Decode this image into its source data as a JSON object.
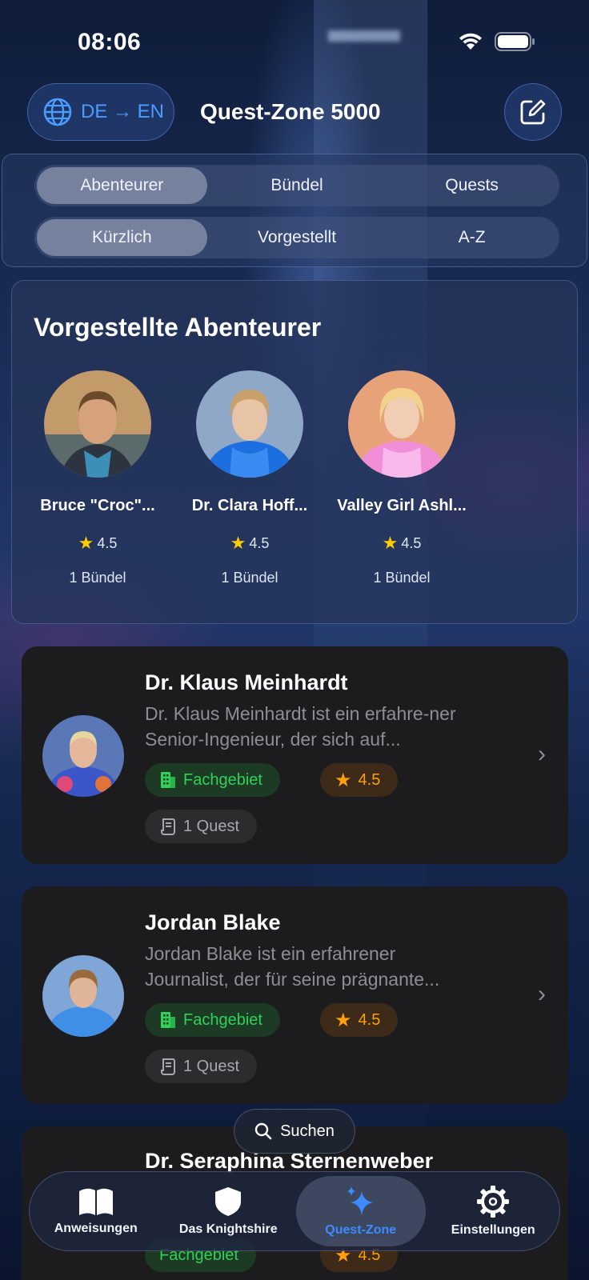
{
  "status": {
    "time": "08:06"
  },
  "header": {
    "language": "DE → EN",
    "title": "Quest-Zone 5000"
  },
  "tabs_primary": [
    "Abenteurer",
    "Bündel",
    "Quests"
  ],
  "tabs_sort": [
    "Kürzlich",
    "Vorgestellt",
    "A-Z"
  ],
  "featured": {
    "title": "Vorgestellte Abenteurer",
    "adventurers": [
      {
        "name": "Bruce \"Croc\"...",
        "rating": "4.5",
        "bundles": "1 Bündel"
      },
      {
        "name": "Dr. Clara Hoff...",
        "rating": "4.5",
        "bundles": "1 Bündel"
      },
      {
        "name": "Valley Girl Ashl...",
        "rating": "4.5",
        "bundles": "1 Bündel"
      }
    ]
  },
  "list": [
    {
      "name": "Dr. Klaus Meinhardt",
      "description": "Dr. Klaus Meinhardt ist ein erfahre-ner Senior-Ingenieur, der sich auf...",
      "tag": "Fachgebiet",
      "rating": "4.5",
      "quests": "1 Quest"
    },
    {
      "name": "Jordan Blake",
      "description": "Jordan Blake ist ein erfahrener Journalist, der für seine prägnante...",
      "tag": "Fachgebiet",
      "rating": "4.5",
      "quests": "1 Quest"
    },
    {
      "name": "Dr. Seraphina Sternenweber",
      "tag": "Fachgebiet",
      "rating": "4.5"
    }
  ],
  "search": {
    "label": "Suchen"
  },
  "tabbar": [
    {
      "label": "Anweisungen",
      "icon": "book-icon"
    },
    {
      "label": "Das Knightshire",
      "icon": "shield-icon"
    },
    {
      "label": "Quest-Zone",
      "icon": "sparkles-icon"
    },
    {
      "label": "Einstellungen",
      "icon": "gear-icon"
    }
  ],
  "colors": {
    "accent": "#3d8bff",
    "green": "#30d158",
    "orange": "#ff9f0a",
    "card": "#1c1c1e"
  }
}
